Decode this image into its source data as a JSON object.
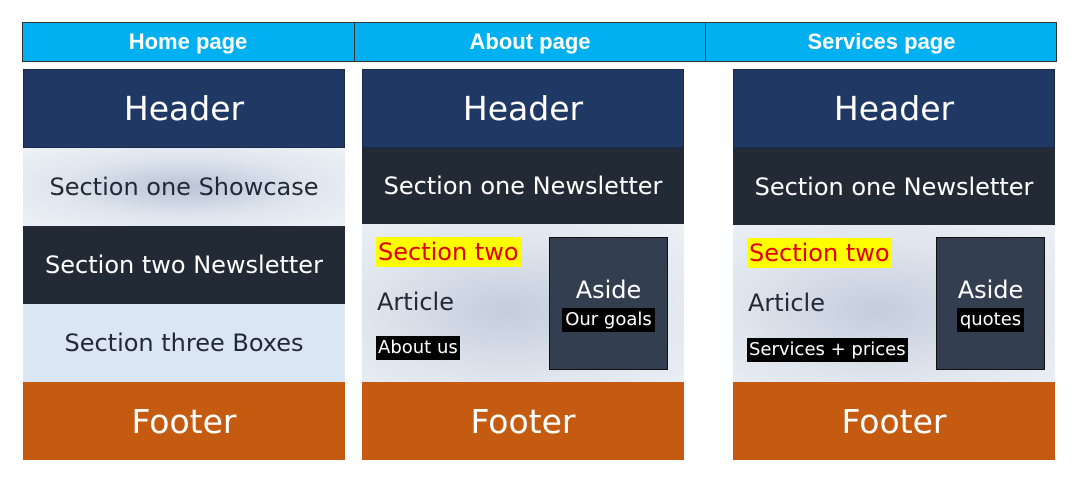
{
  "columns": [
    {
      "title": "Home page",
      "header": "Header",
      "sections": [
        "Section one Showcase",
        "Section two Newsletter",
        "Section three Boxes"
      ],
      "footer": "Footer"
    },
    {
      "title": "About page",
      "header": "Header",
      "section_one": "Section one Newsletter",
      "section_two": "Section two",
      "article": "Article",
      "article_tag": "About us",
      "aside": "Aside",
      "aside_tag": "Our goals",
      "footer": "Footer"
    },
    {
      "title": "Services page",
      "header": "Header",
      "section_one": "Section one Newsletter",
      "section_two": "Section two",
      "article": "Article",
      "article_tag": "Services + prices",
      "aside": "Aside",
      "aside_tag": "quotes",
      "footer": "Footer"
    }
  ],
  "colors": {
    "title_bar": "#00b0f0",
    "header": "#203864",
    "dark_section": "#222a35",
    "footer": "#c55a11",
    "highlight": "#ffff00",
    "highlight_text": "#e00000",
    "aside": "#333f50"
  }
}
